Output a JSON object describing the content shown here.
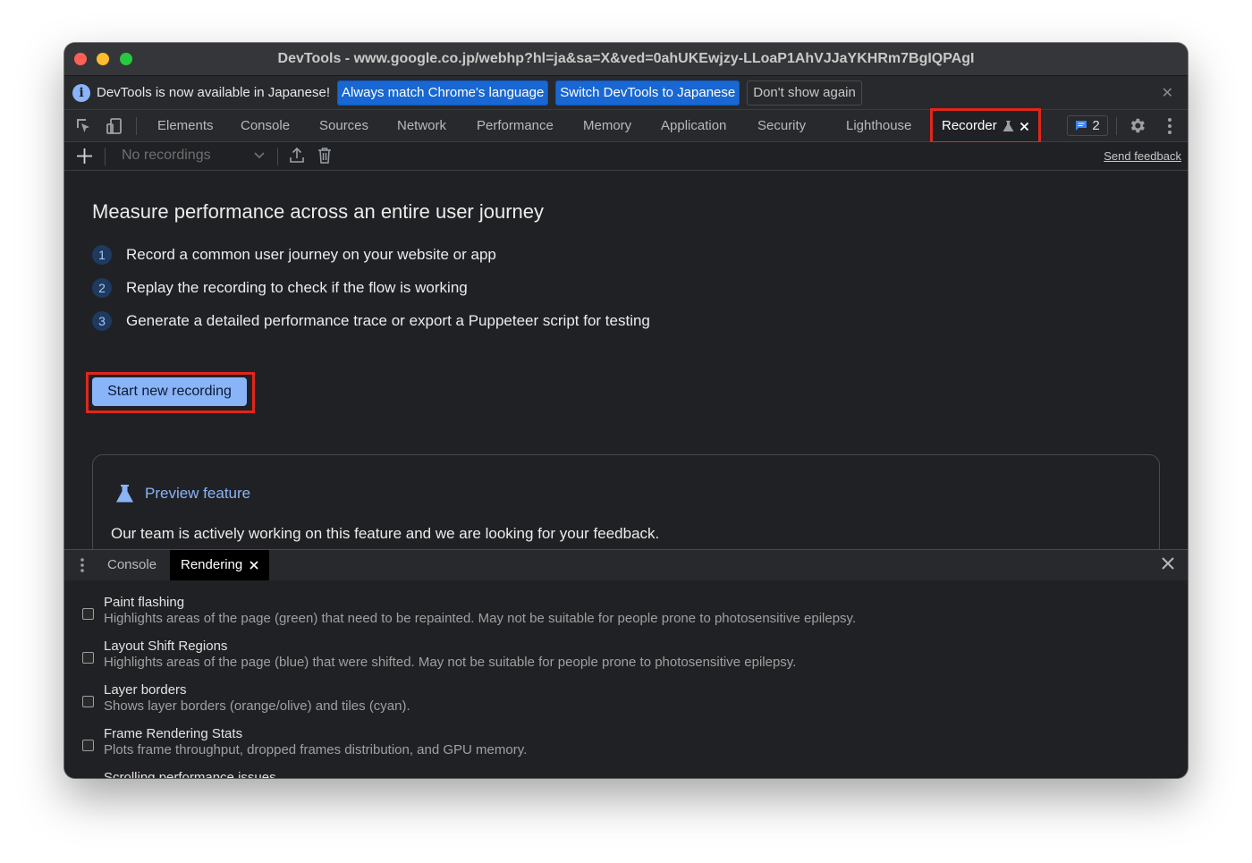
{
  "window": {
    "title": "DevTools - www.google.co.jp/webhp?hl=ja&sa=X&ved=0ahUKEwjzy-LLoaP1AhVJJaYKHRm7BgIQPAgI"
  },
  "infobar": {
    "message": "DevTools is now available in Japanese!",
    "match_language_label": "Always match Chrome's language",
    "switch_label": "Switch DevTools to Japanese",
    "dismiss_label": "Don't show again",
    "close_glyph": "✕"
  },
  "tabs": {
    "items": [
      "Elements",
      "Console",
      "Sources",
      "Network",
      "Performance",
      "Memory",
      "Application",
      "Security",
      "Lighthouse"
    ],
    "active": "Recorder",
    "issues_count": "2"
  },
  "recorder_toolbar": {
    "recordings_select": "No recordings",
    "send_feedback": "Send feedback"
  },
  "recorder": {
    "heading": "Measure performance across an entire user journey",
    "steps": [
      {
        "num": "1",
        "text": "Record a common user journey on your website or app"
      },
      {
        "num": "2",
        "text": "Replay the recording to check if the flow is working"
      },
      {
        "num": "3",
        "text": "Generate a detailed performance trace or export a Puppeteer script for testing"
      }
    ],
    "start_button": "Start new recording",
    "preview_title": "Preview feature",
    "preview_text": "Our team is actively working on this feature and we are looking for your feedback."
  },
  "drawer": {
    "tabs": [
      "Console",
      "Rendering"
    ],
    "active": "Rendering"
  },
  "rendering": {
    "options": [
      {
        "label": "Paint flashing",
        "desc": "Highlights areas of the page (green) that need to be repainted. May not be suitable for people prone to photosensitive epilepsy."
      },
      {
        "label": "Layout Shift Regions",
        "desc": "Highlights areas of the page (blue) that were shifted. May not be suitable for people prone to photosensitive epilepsy."
      },
      {
        "label": "Layer borders",
        "desc": "Shows layer borders (orange/olive) and tiles (cyan)."
      },
      {
        "label": "Frame Rendering Stats",
        "desc": "Plots frame throughput, dropped frames distribution, and GPU memory."
      },
      {
        "label": "Scrolling performance issues",
        "desc": ""
      }
    ]
  },
  "colors": {
    "highlight": "#e0271a",
    "accent": "#8ab4f8",
    "primary_button": "#1967d2"
  }
}
